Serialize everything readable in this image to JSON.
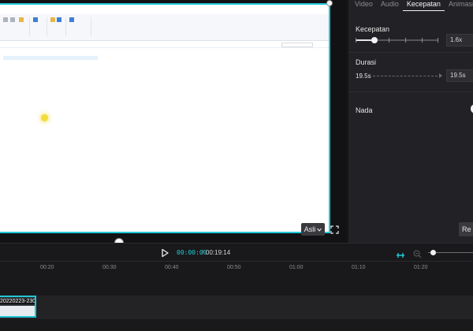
{
  "tabs": [
    "Video",
    "Audio",
    "Kecepatan",
    "Animasi"
  ],
  "active_tab": "Kecepatan",
  "speed": {
    "label": "Kecepatan",
    "value": "1.6x",
    "slider_fraction": 0.23
  },
  "duration": {
    "label": "Durasi",
    "original": "19.5s",
    "value": "19.5s"
  },
  "pitch": {
    "label": "Nada"
  },
  "reset_label": "Re",
  "preview": {
    "ratio_label": "Asli"
  },
  "playback": {
    "current": "00:00:00",
    "separator": "/",
    "total": "00:19:14"
  },
  "zoom_fraction": 0.05,
  "ruler": [
    "00:20",
    "00:30",
    "00:40",
    "00:50",
    "01:00",
    "01:10",
    "01:20"
  ],
  "clip": {
    "name": "20220223-230"
  },
  "colors": {
    "accent": "#22c8d8",
    "panel": "#222226",
    "background": "#1a1a1c"
  },
  "icons": [
    "play-icon",
    "fullscreen-icon",
    "chevron-down-icon",
    "snap-icon",
    "zoom-out-icon"
  ]
}
